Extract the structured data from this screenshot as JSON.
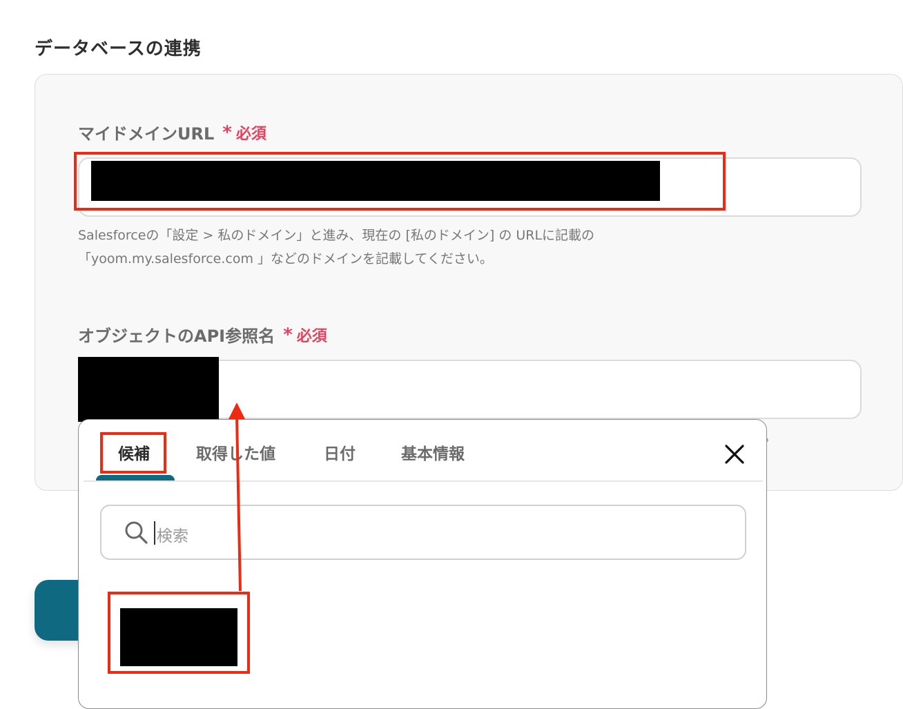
{
  "section": {
    "title": "データベースの連携"
  },
  "fields": {
    "domain": {
      "label": "マイドメインURL",
      "required_mark": "*",
      "required_text": "必須",
      "help_line1": "Salesforceの「設定 > 私のドメイン」と進み、現在の [私のドメイン] の URLに記載の",
      "help_line2": "「yoom.my.salesforce.com 」などのドメインを記載してください。"
    },
    "object_api": {
      "label": "オブジェクトのAPI参照名",
      "required_mark": "*",
      "required_text": "必須",
      "help_fragment": "。"
    }
  },
  "popup": {
    "tabs": [
      "候補",
      "取得した値",
      "日付",
      "基本情報"
    ],
    "active_tab": "候補",
    "search": {
      "placeholder": "検索"
    }
  },
  "colors": {
    "required": "#e8415c",
    "accent": "#0f6a81",
    "highlight": "#ee2a12"
  },
  "icons": {
    "close": "close-icon",
    "search": "search-icon"
  }
}
